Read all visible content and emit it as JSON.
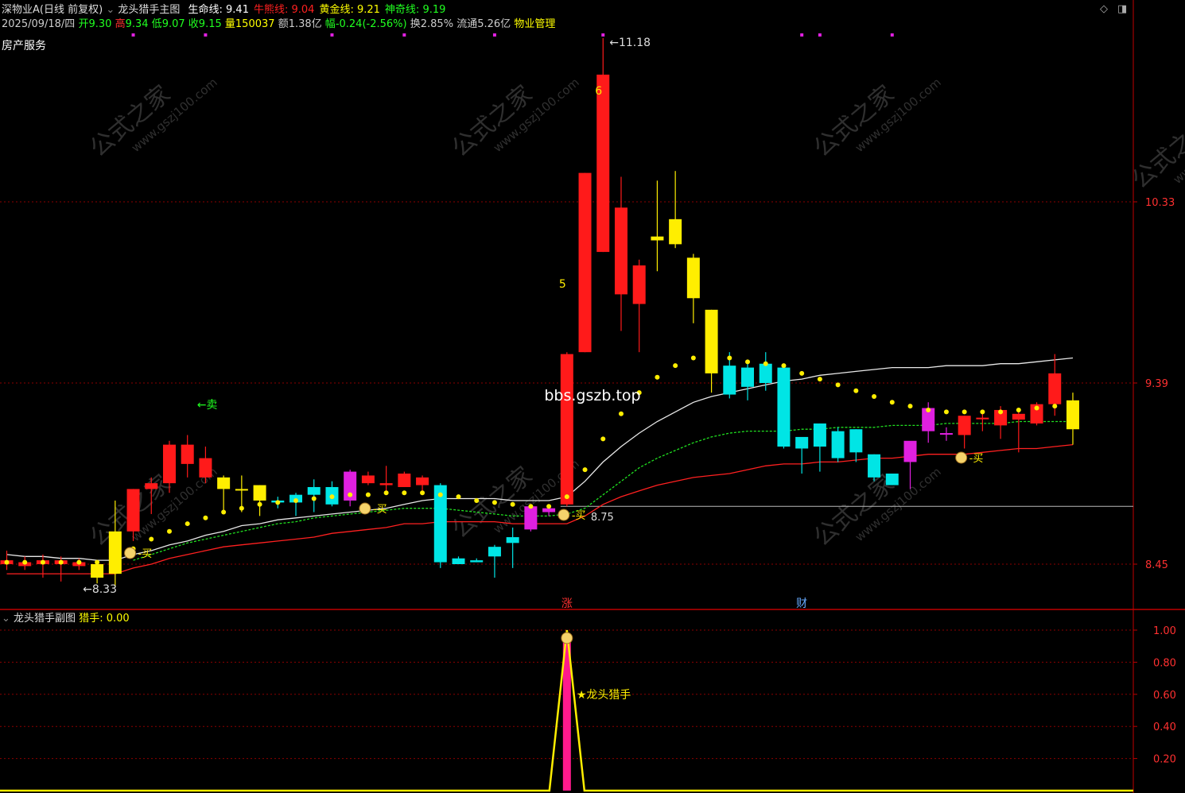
{
  "header": {
    "title": "深物业A(日线 前复权)",
    "indicator_name": "龙头猎手主图",
    "lines": [
      {
        "label": "生命线",
        "value": "9.41",
        "color": "#ffffff"
      },
      {
        "label": "牛熊线",
        "value": "9.04",
        "color": "#ff2020"
      },
      {
        "label": "黄金线",
        "value": "9.21",
        "color": "#ffff00"
      },
      {
        "label": "神奇线",
        "value": "9.19",
        "color": "#20ff20"
      }
    ],
    "date": "2025/09/18/四",
    "open_label": "开",
    "open": "9.30",
    "high_label": "高",
    "high": "9.34",
    "low_label": "低",
    "low": "9.07",
    "close_label": "收",
    "close": "9.15",
    "volume_label": "量",
    "volume": "150037",
    "amount_label": "额",
    "amount": "1.38亿",
    "change_label": "幅",
    "change": "-0.24(-2.56%)",
    "turnover_label": "换",
    "turnover": "2.85%",
    "float_label": "流通",
    "float": "5.26亿",
    "industry": "物业管理",
    "sector": "房产服务",
    "watermark_site": "bbs.gszb.top",
    "watermark_brand": "公式之家",
    "watermark_url": "www.gszj100.com"
  },
  "sub_header": {
    "name": "龙头猎手副图",
    "label": "猎手",
    "value": "0.00"
  },
  "chart_data": [
    {
      "type": "candlestick",
      "title": "龙头猎手主图",
      "ylim": [
        8.2,
        11.3
      ],
      "yticks": [
        "10.33",
        "9.39",
        "8.45"
      ],
      "candles": [
        {
          "o": 8.45,
          "h": 8.52,
          "l": 8.42,
          "c": 8.47,
          "color": "red"
        },
        {
          "o": 8.44,
          "h": 8.49,
          "l": 8.42,
          "c": 8.46,
          "color": "red"
        },
        {
          "o": 8.45,
          "h": 8.5,
          "l": 8.38,
          "c": 8.47,
          "color": "red"
        },
        {
          "o": 8.45,
          "h": 8.49,
          "l": 8.36,
          "c": 8.47,
          "color": "red"
        },
        {
          "o": 8.44,
          "h": 8.48,
          "l": 8.42,
          "c": 8.46,
          "color": "red"
        },
        {
          "o": 8.45,
          "h": 8.47,
          "l": 8.35,
          "c": 8.38,
          "color": "yellow"
        },
        {
          "o": 8.4,
          "h": 8.78,
          "l": 8.33,
          "c": 8.62,
          "color": "yellow"
        },
        {
          "o": 8.62,
          "h": 8.84,
          "l": 8.57,
          "c": 8.84,
          "color": "red"
        },
        {
          "o": 8.84,
          "h": 8.9,
          "l": 8.71,
          "c": 8.87,
          "color": "red"
        },
        {
          "o": 8.87,
          "h": 9.09,
          "l": 8.82,
          "c": 9.07,
          "color": "red"
        },
        {
          "o": 8.97,
          "h": 9.12,
          "l": 8.9,
          "c": 9.07,
          "color": "red"
        },
        {
          "o": 9.0,
          "h": 9.06,
          "l": 8.87,
          "c": 8.9,
          "color": "red"
        },
        {
          "o": 8.9,
          "h": 8.91,
          "l": 8.71,
          "c": 8.84,
          "color": "yellow"
        },
        {
          "o": 8.84,
          "h": 8.91,
          "l": 8.72,
          "c": 8.84,
          "color": "yellow"
        },
        {
          "o": 8.86,
          "h": 8.86,
          "l": 8.7,
          "c": 8.78,
          "color": "yellow"
        },
        {
          "o": 8.77,
          "h": 8.8,
          "l": 8.74,
          "c": 8.78,
          "color": "cyan"
        },
        {
          "o": 8.77,
          "h": 8.82,
          "l": 8.7,
          "c": 8.81,
          "color": "cyan"
        },
        {
          "o": 8.81,
          "h": 8.89,
          "l": 8.72,
          "c": 8.85,
          "color": "cyan"
        },
        {
          "o": 8.76,
          "h": 8.88,
          "l": 8.75,
          "c": 8.85,
          "color": "cyan"
        },
        {
          "o": 8.78,
          "h": 8.94,
          "l": 8.75,
          "c": 8.93,
          "color": "magenta"
        },
        {
          "o": 8.91,
          "h": 8.93,
          "l": 8.86,
          "c": 8.87,
          "color": "red"
        },
        {
          "o": 8.86,
          "h": 8.96,
          "l": 8.81,
          "c": 8.87,
          "color": "red"
        },
        {
          "o": 8.85,
          "h": 8.93,
          "l": 8.85,
          "c": 8.92,
          "color": "red"
        },
        {
          "o": 8.86,
          "h": 8.91,
          "l": 8.82,
          "c": 8.9,
          "color": "red"
        },
        {
          "o": 8.46,
          "h": 8.87,
          "l": 8.43,
          "c": 8.86,
          "color": "cyan"
        },
        {
          "o": 8.45,
          "h": 8.49,
          "l": 8.45,
          "c": 8.48,
          "color": "cyan"
        },
        {
          "o": 8.46,
          "h": 8.48,
          "l": 8.46,
          "c": 8.47,
          "color": "cyan"
        },
        {
          "o": 8.49,
          "h": 8.55,
          "l": 8.38,
          "c": 8.54,
          "color": "cyan"
        },
        {
          "o": 8.56,
          "h": 8.64,
          "l": 8.43,
          "c": 8.59,
          "color": "cyan"
        },
        {
          "o": 8.63,
          "h": 8.75,
          "l": 8.62,
          "c": 8.75,
          "color": "magenta"
        },
        {
          "o": 8.72,
          "h": 8.76,
          "l": 8.7,
          "c": 8.74,
          "color": "magenta"
        },
        {
          "o": 8.76,
          "h": 9.55,
          "l": 8.75,
          "c": 9.54,
          "color": "red"
        },
        {
          "o": 9.55,
          "h": 10.48,
          "l": 9.55,
          "c": 10.48,
          "color": "red"
        },
        {
          "o": 10.07,
          "h": 11.18,
          "l": 10.07,
          "c": 10.99,
          "color": "red"
        },
        {
          "o": 10.3,
          "h": 10.46,
          "l": 9.66,
          "c": 9.85,
          "color": "red"
        },
        {
          "o": 9.8,
          "h": 10.03,
          "l": 9.55,
          "c": 10.0,
          "color": "red"
        },
        {
          "o": 10.13,
          "h": 10.44,
          "l": 9.97,
          "c": 10.15,
          "color": "yellow"
        },
        {
          "o": 10.24,
          "h": 10.49,
          "l": 10.09,
          "c": 10.11,
          "color": "yellow"
        },
        {
          "o": 10.04,
          "h": 10.06,
          "l": 9.7,
          "c": 9.83,
          "color": "yellow"
        },
        {
          "o": 9.77,
          "h": 9.77,
          "l": 9.34,
          "c": 9.44,
          "color": "yellow"
        },
        {
          "o": 9.33,
          "h": 9.55,
          "l": 9.31,
          "c": 9.48,
          "color": "cyan"
        },
        {
          "o": 9.37,
          "h": 9.5,
          "l": 9.3,
          "c": 9.47,
          "color": "cyan"
        },
        {
          "o": 9.39,
          "h": 9.55,
          "l": 9.35,
          "c": 9.49,
          "color": "cyan"
        },
        {
          "o": 9.06,
          "h": 9.47,
          "l": 9.05,
          "c": 9.47,
          "color": "cyan"
        },
        {
          "o": 9.05,
          "h": 9.1,
          "l": 8.92,
          "c": 9.11,
          "color": "cyan"
        },
        {
          "o": 9.06,
          "h": 9.18,
          "l": 8.93,
          "c": 9.18,
          "color": "cyan"
        },
        {
          "o": 9.0,
          "h": 9.16,
          "l": 8.98,
          "c": 9.14,
          "color": "cyan"
        },
        {
          "o": 9.03,
          "h": 9.15,
          "l": 8.98,
          "c": 9.15,
          "color": "cyan"
        },
        {
          "o": 8.9,
          "h": 9.02,
          "l": 8.88,
          "c": 9.02,
          "color": "cyan"
        },
        {
          "o": 8.86,
          "h": 8.92,
          "l": 8.86,
          "c": 8.92,
          "color": "cyan"
        },
        {
          "o": 8.98,
          "h": 9.06,
          "l": 8.84,
          "c": 9.09,
          "color": "magenta"
        },
        {
          "o": 9.14,
          "h": 9.29,
          "l": 9.08,
          "c": 9.26,
          "color": "magenta"
        },
        {
          "o": 9.13,
          "h": 9.16,
          "l": 9.09,
          "c": 9.13,
          "color": "magenta"
        },
        {
          "o": 9.22,
          "h": 9.22,
          "l": 9.05,
          "c": 9.12,
          "color": "red"
        },
        {
          "o": 9.21,
          "h": 9.24,
          "l": 9.14,
          "c": 9.21,
          "color": "red"
        },
        {
          "o": 9.17,
          "h": 9.27,
          "l": 9.1,
          "c": 9.25,
          "color": "red"
        },
        {
          "o": 9.2,
          "h": 9.26,
          "l": 9.03,
          "c": 9.23,
          "color": "red"
        },
        {
          "o": 9.18,
          "h": 9.29,
          "l": 9.17,
          "c": 9.28,
          "color": "red"
        },
        {
          "o": 9.28,
          "h": 9.54,
          "l": 9.22,
          "c": 9.44,
          "color": "red"
        },
        {
          "o": 9.3,
          "h": 9.34,
          "l": 9.07,
          "c": 9.15,
          "color": "yellow"
        }
      ],
      "series": [
        {
          "name": "生命线",
          "color": "#e8e8e8",
          "dashed": false,
          "values": [
            8.5,
            8.49,
            8.49,
            8.48,
            8.48,
            8.47,
            8.47,
            8.5,
            8.52,
            8.55,
            8.57,
            8.6,
            8.62,
            8.65,
            8.66,
            8.68,
            8.69,
            8.7,
            8.71,
            8.72,
            8.73,
            8.74,
            8.76,
            8.78,
            8.79,
            8.79,
            8.79,
            8.79,
            8.78,
            8.78,
            8.78,
            8.8,
            8.88,
            8.98,
            9.06,
            9.13,
            9.19,
            9.24,
            9.29,
            9.32,
            9.34,
            9.36,
            9.38,
            9.4,
            9.41,
            9.43,
            9.44,
            9.45,
            9.46,
            9.47,
            9.47,
            9.47,
            9.48,
            9.48,
            9.48,
            9.49,
            9.49,
            9.5,
            9.51,
            9.52
          ]
        },
        {
          "name": "牛熊线",
          "color": "#ff2020",
          "dashed": false,
          "values": [
            8.4,
            8.4,
            8.4,
            8.4,
            8.4,
            8.4,
            8.4,
            8.43,
            8.45,
            8.48,
            8.5,
            8.52,
            8.54,
            8.55,
            8.56,
            8.57,
            8.58,
            8.59,
            8.61,
            8.62,
            8.63,
            8.64,
            8.66,
            8.66,
            8.67,
            8.67,
            8.67,
            8.67,
            8.66,
            8.66,
            8.66,
            8.66,
            8.7,
            8.76,
            8.8,
            8.83,
            8.86,
            8.88,
            8.9,
            8.91,
            8.92,
            8.94,
            8.96,
            8.97,
            8.97,
            8.98,
            8.98,
            8.99,
            9.0,
            9.0,
            9.01,
            9.02,
            9.02,
            9.02,
            9.03,
            9.04,
            9.05,
            9.05,
            9.06,
            9.07
          ]
        },
        {
          "name": "神奇线",
          "color": "#20e020",
          "dashed": true,
          "values": [
            null,
            null,
            null,
            null,
            null,
            null,
            null,
            8.47,
            8.5,
            8.53,
            8.56,
            8.58,
            8.6,
            8.62,
            8.64,
            8.66,
            8.67,
            8.69,
            8.7,
            8.71,
            8.72,
            8.73,
            8.74,
            8.74,
            8.74,
            8.73,
            8.72,
            8.71,
            8.7,
            8.7,
            8.7,
            8.71,
            8.74,
            8.81,
            8.88,
            8.95,
            9.0,
            9.04,
            9.08,
            9.11,
            9.13,
            9.14,
            9.14,
            9.14,
            9.15,
            9.15,
            9.16,
            9.16,
            9.16,
            9.17,
            9.17,
            9.17,
            9.18,
            9.18,
            9.18,
            9.18,
            9.19,
            9.19,
            9.19,
            9.19
          ]
        }
      ],
      "dots": [
        8.46,
        8.46,
        8.46,
        8.46,
        8.46,
        8.46,
        8.48,
        8.53,
        8.58,
        8.62,
        8.66,
        8.69,
        8.72,
        8.74,
        8.76,
        8.77,
        8.78,
        8.79,
        8.8,
        8.81,
        8.81,
        8.82,
        8.82,
        8.82,
        8.81,
        8.8,
        8.78,
        8.77,
        8.76,
        8.75,
        8.75,
        8.8,
        8.94,
        9.1,
        9.23,
        9.34,
        9.42,
        9.48,
        9.52,
        9.53,
        9.52,
        9.5,
        9.49,
        9.48,
        9.44,
        9.41,
        9.38,
        9.35,
        9.32,
        9.29,
        9.27,
        9.25,
        9.24,
        9.24,
        9.24,
        9.24,
        9.25,
        9.26,
        9.27,
        9.28
      ],
      "hline": 8.75,
      "annotations": [
        {
          "i": 5,
          "text": "8.33",
          "type": "low"
        },
        {
          "i": 33,
          "text": "11.18",
          "type": "high"
        },
        {
          "i": 31,
          "text": "8.75",
          "type": "hline-label"
        },
        {
          "i": 33,
          "text": "6",
          "type": "count"
        },
        {
          "i": 31,
          "text": "5",
          "type": "count"
        },
        {
          "i": 10,
          "text": "卖",
          "type": "sell"
        },
        {
          "i": 7,
          "text": "买",
          "type": "buy"
        },
        {
          "i": 20,
          "text": "买",
          "type": "buy"
        },
        {
          "i": 31,
          "text": "买",
          "type": "buy"
        },
        {
          "i": 53,
          "text": "买",
          "type": "buy"
        },
        {
          "i": 31,
          "text": "涨",
          "type": "event"
        },
        {
          "i": 44,
          "text": "财",
          "type": "event"
        }
      ]
    },
    {
      "type": "line",
      "title": "龙头猎手副图",
      "ylim": [
        0,
        1.1
      ],
      "yticks": [
        "1.00",
        "0.80",
        "0.60",
        "0.40",
        "0.20"
      ],
      "series": [
        {
          "name": "猎手",
          "values_by_index": {
            "31": 1.0
          }
        }
      ],
      "label": "★龙头猎手"
    }
  ]
}
